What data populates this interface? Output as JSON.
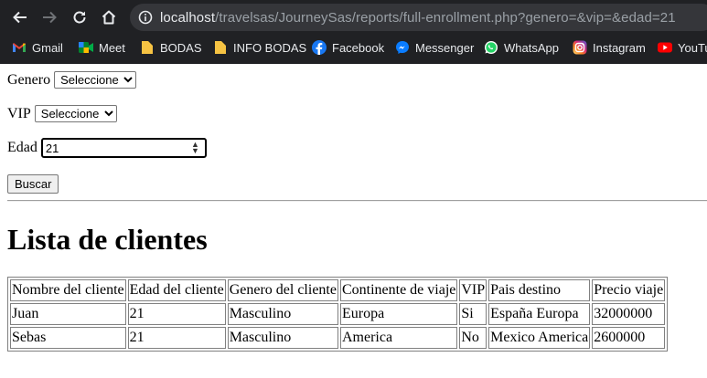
{
  "browser": {
    "url_host": "localhost",
    "url_path": "/travelsas/JourneySas/reports/full-enrollment.php?genero=&vip=&edad=21",
    "bookmarks": [
      {
        "label": "Gmail",
        "icon": "gmail-icon"
      },
      {
        "label": "Meet",
        "icon": "meet-icon"
      },
      {
        "label": "BODAS",
        "icon": "folder-icon"
      },
      {
        "label": "INFO BODAS",
        "icon": "folder-icon"
      },
      {
        "label": "Facebook",
        "icon": "facebook-icon"
      },
      {
        "label": "Messenger",
        "icon": "messenger-icon"
      },
      {
        "label": "WhatsApp",
        "icon": "whatsapp-icon"
      },
      {
        "label": "Instagram",
        "icon": "instagram-icon"
      },
      {
        "label": "YouTu",
        "icon": "youtube-icon"
      }
    ]
  },
  "form": {
    "genero_label": "Genero",
    "genero_value": "Seleccione",
    "vip_label": "VIP",
    "vip_value": "Seleccione",
    "edad_label": "Edad",
    "edad_value": "21",
    "submit_label": "Buscar"
  },
  "title": "Lista de clientes",
  "table": {
    "headers": [
      "Nombre del cliente",
      "Edad del cliente",
      "Genero del cliente",
      "Continente de viaje",
      "VIP",
      "Pais destino",
      "Precio viaje"
    ],
    "rows": [
      [
        "Juan",
        "21",
        "Masculino",
        "Europa",
        "Si",
        "España Europa",
        "32000000"
      ],
      [
        "Sebas",
        "21",
        "Masculino",
        "America",
        "No",
        "Mexico America",
        "2600000"
      ]
    ]
  }
}
